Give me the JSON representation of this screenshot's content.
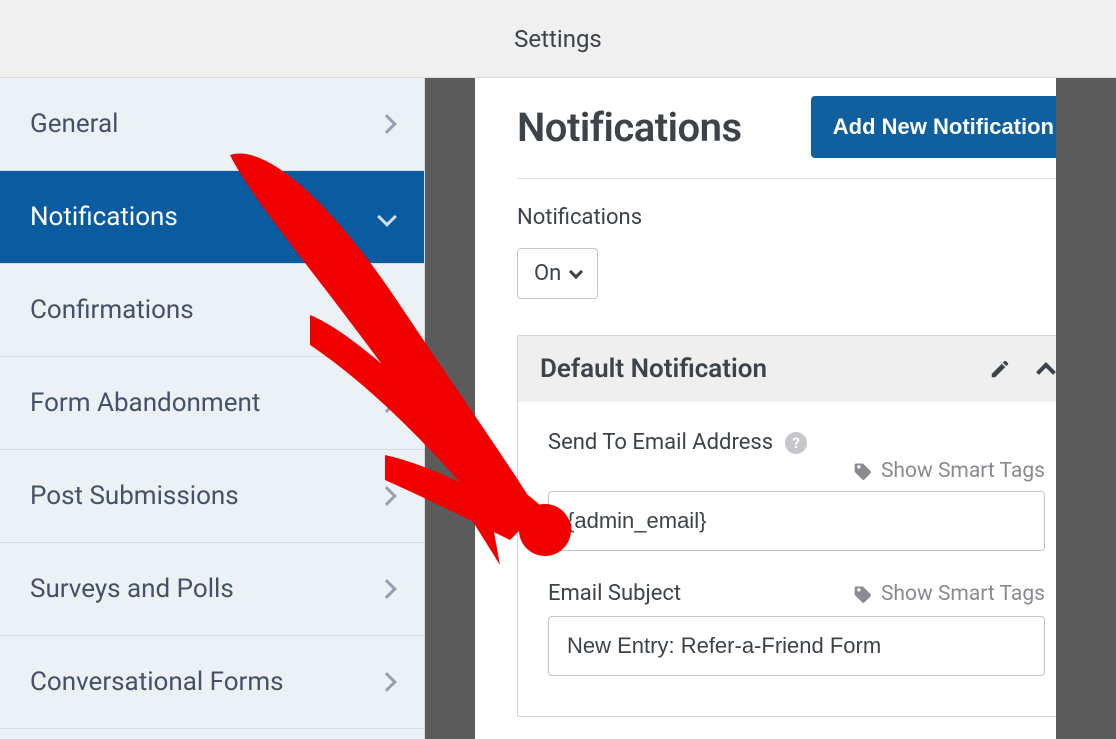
{
  "header": {
    "title": "Settings"
  },
  "sidebar": {
    "items": [
      {
        "label": "General",
        "selected": false
      },
      {
        "label": "Notifications",
        "selected": true
      },
      {
        "label": "Confirmations",
        "selected": false
      },
      {
        "label": "Form Abandonment",
        "selected": false
      },
      {
        "label": "Post Submissions",
        "selected": false
      },
      {
        "label": "Surveys and Polls",
        "selected": false
      },
      {
        "label": "Conversational Forms",
        "selected": false
      }
    ]
  },
  "main": {
    "heading": "Notifications",
    "add_button": "Add New Notification",
    "toggle_label": "Notifications",
    "toggle_value": "On",
    "card": {
      "title": "Default Notification",
      "fields": {
        "send_to": {
          "label": "Send To Email Address",
          "smart_tags": "Show Smart Tags",
          "value": "{admin_email}"
        },
        "subject": {
          "label": "Email Subject",
          "smart_tags": "Show Smart Tags",
          "value": "New Entry: Refer-a-Friend Form"
        }
      }
    }
  },
  "colors": {
    "accent_sidebar": "#0b5ba1",
    "accent_button": "#105f9e",
    "arrow": "#f20000"
  }
}
